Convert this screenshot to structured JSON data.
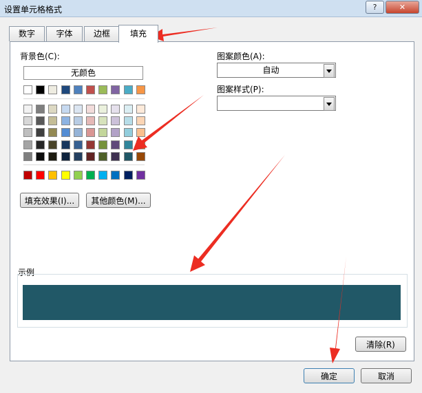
{
  "window": {
    "title": "设置单元格格式",
    "help_label": "?",
    "close_label": "✕"
  },
  "tabs": [
    {
      "label": "数字",
      "active": false
    },
    {
      "label": "字体",
      "active": false
    },
    {
      "label": "边框",
      "active": false
    },
    {
      "label": "填充",
      "active": true
    }
  ],
  "fill": {
    "background_color_label": "背景色(C):",
    "no_color_label": "无颜色",
    "fill_effects_label": "填充效果(I)...",
    "more_colors_label": "其他颜色(M)...",
    "pattern_color_label": "图案颜色(A):",
    "pattern_color_value": "自动",
    "pattern_style_label": "图案样式(P):",
    "pattern_style_value": ""
  },
  "palette": {
    "theme_top": [
      "#ffffff",
      "#000000",
      "#eeece1",
      "#1f497d",
      "#4f81bd",
      "#c0504d",
      "#9bbb59",
      "#8064a2",
      "#4bacc6",
      "#f79646"
    ],
    "theme_shades": [
      [
        "#f2f2f2",
        "#7f7f7f",
        "#ddd9c3",
        "#c6d9f0",
        "#dbe5f1",
        "#f2dcdb",
        "#ebf1dd",
        "#e5e0ec",
        "#dbeef3",
        "#fdeada"
      ],
      [
        "#d8d8d8",
        "#595959",
        "#c4bd97",
        "#8db3e2",
        "#b8cce4",
        "#e5b9b7",
        "#d7e3bc",
        "#ccc1d9",
        "#b7dde8",
        "#fbd5b5"
      ],
      [
        "#bfbfbf",
        "#3f3f3f",
        "#938953",
        "#548dd4",
        "#95b3d7",
        "#d99694",
        "#c3d69b",
        "#b2a2c7",
        "#92cddc",
        "#fac08f"
      ],
      [
        "#a5a5a5",
        "#262626",
        "#494429",
        "#17365d",
        "#366092",
        "#953734",
        "#76923c",
        "#5f497a",
        "#31859b",
        "#e36c09"
      ],
      [
        "#7f7f7f",
        "#0c0c0c",
        "#1d1b10",
        "#0f243e",
        "#244061",
        "#632423",
        "#4f6128",
        "#3f3151",
        "#205867",
        "#974806"
      ]
    ],
    "standard": [
      "#c00000",
      "#ff0000",
      "#ffc000",
      "#ffff00",
      "#92d050",
      "#00b050",
      "#00b0f0",
      "#0070c0",
      "#002060",
      "#7030a0"
    ],
    "selected_color": "#215867"
  },
  "sample": {
    "label": "示例",
    "color": "#215867"
  },
  "buttons": {
    "clear_label": "清除(R)",
    "ok_label": "确定",
    "cancel_label": "取消"
  },
  "accent": {
    "annotation_arrow": "#ec2d22"
  }
}
